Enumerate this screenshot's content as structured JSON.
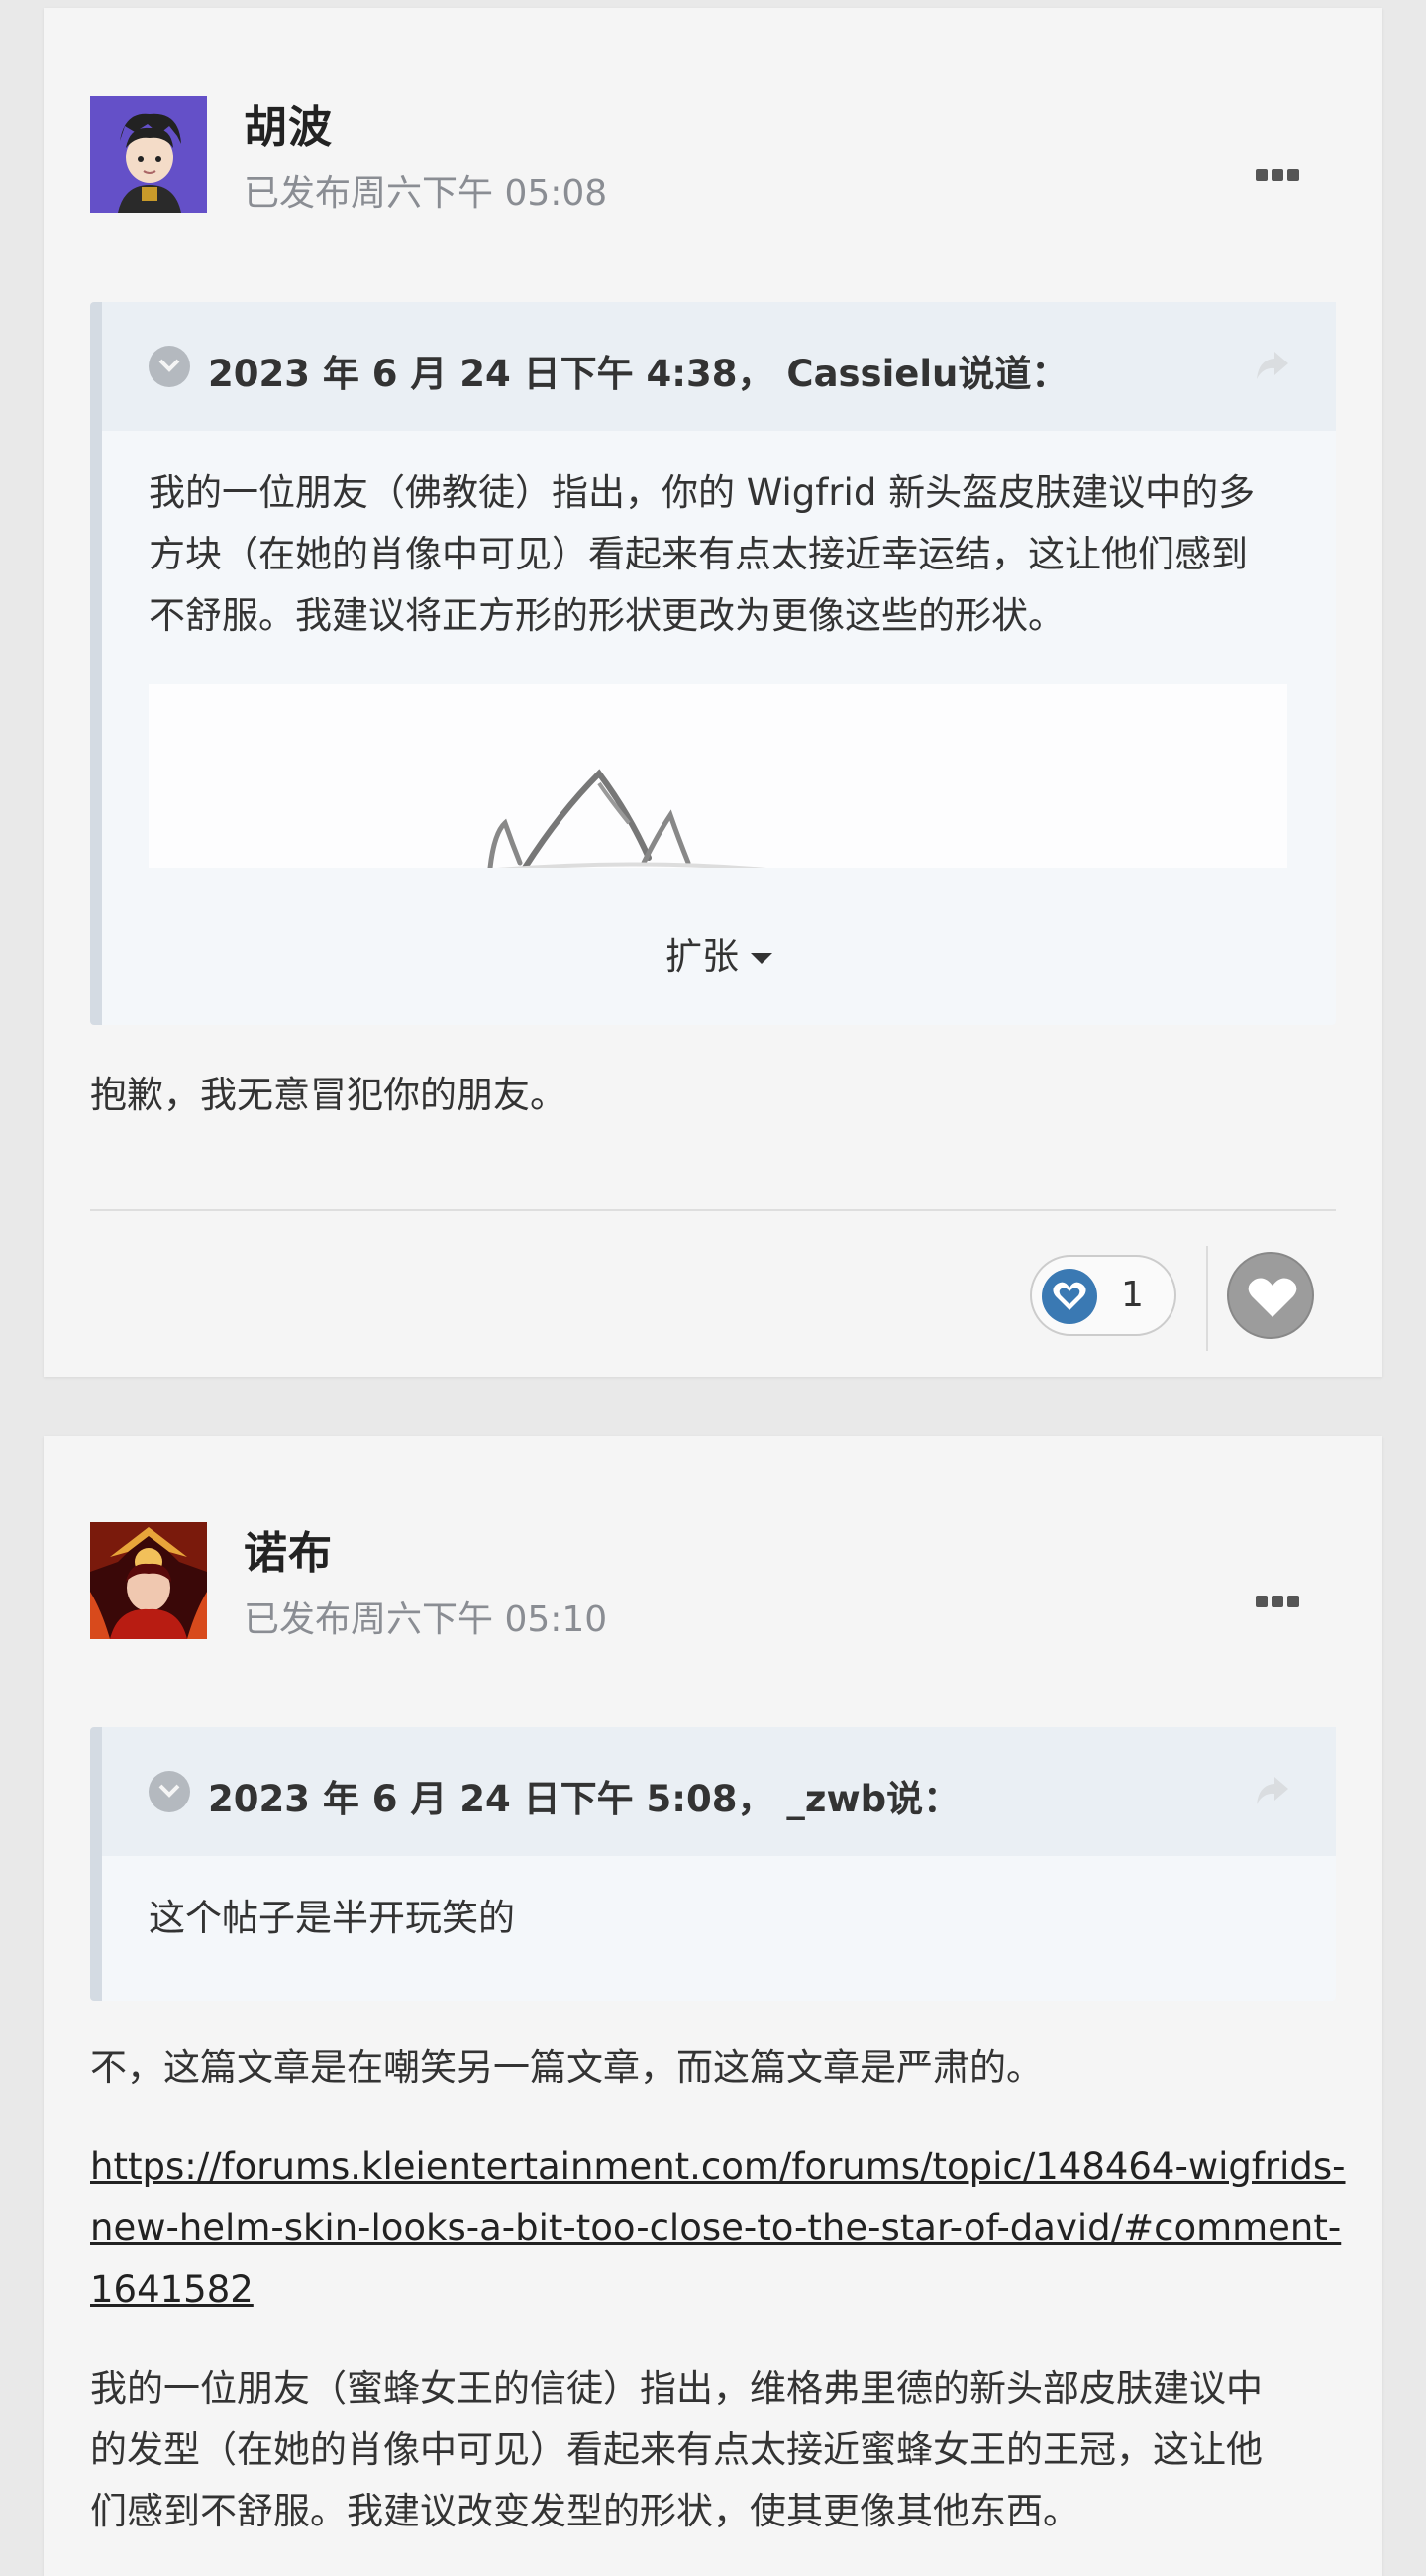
{
  "posts": [
    {
      "author": "胡波",
      "meta": "已发布周六下午 05:08",
      "quote": {
        "cite": "2023 年 6 月 24 日下午 4:38， Cassielu说道：",
        "lines": [
          "我的一位朋友（佛教徒）指出，你的 Wigfrid 新头盔皮肤建议中的多",
          "方块（在她的肖像中可见）看起来有点太接近幸运结，这让他们感到",
          "不舒服。我建议将正方形的形状更改为更像这些的形状。"
        ],
        "expand_label": "扩张"
      },
      "body": "抱歉，我无意冒犯你的朋友。",
      "reaction_count": "1"
    },
    {
      "author": "诺布",
      "meta": "已发布周六下午 05:10",
      "quote": {
        "cite": "2023 年 6 月 24 日下午 5:08， _zwb说：",
        "lines": [
          "这个帖子是半开玩笑的"
        ]
      },
      "body": "不，这篇文章是在嘲笑另一篇文章，而这篇文章是严肃的。",
      "link_lines": [
        "https://forums.kleientertainment.com/forums/topic/148464-wigfrids-",
        "new-helm-skin-looks-a-bit-too-close-to-the-star-of-david/#comment-",
        "1641582"
      ],
      "body2_lines": [
        "我的一位朋友（蜜蜂女王的信徒）指出，维格弗里德的新头部皮肤建议中",
        "的发型（在她的肖像中可见）看起来有点太接近蜜蜂女王的王冠，这让他",
        "们感到不舒服。我建议改变发型的形状，使其更像其他东西。"
      ]
    }
  ],
  "icons": {
    "more": "ellipsis-icon",
    "toggle": "chevron-down-circle-icon",
    "share": "share-arrow-icon",
    "heart": "heart-icon",
    "caret": "caret-down-icon"
  },
  "colors": {
    "reaction_heart": "#3a79b3",
    "react_button": "#9c9c9c"
  }
}
